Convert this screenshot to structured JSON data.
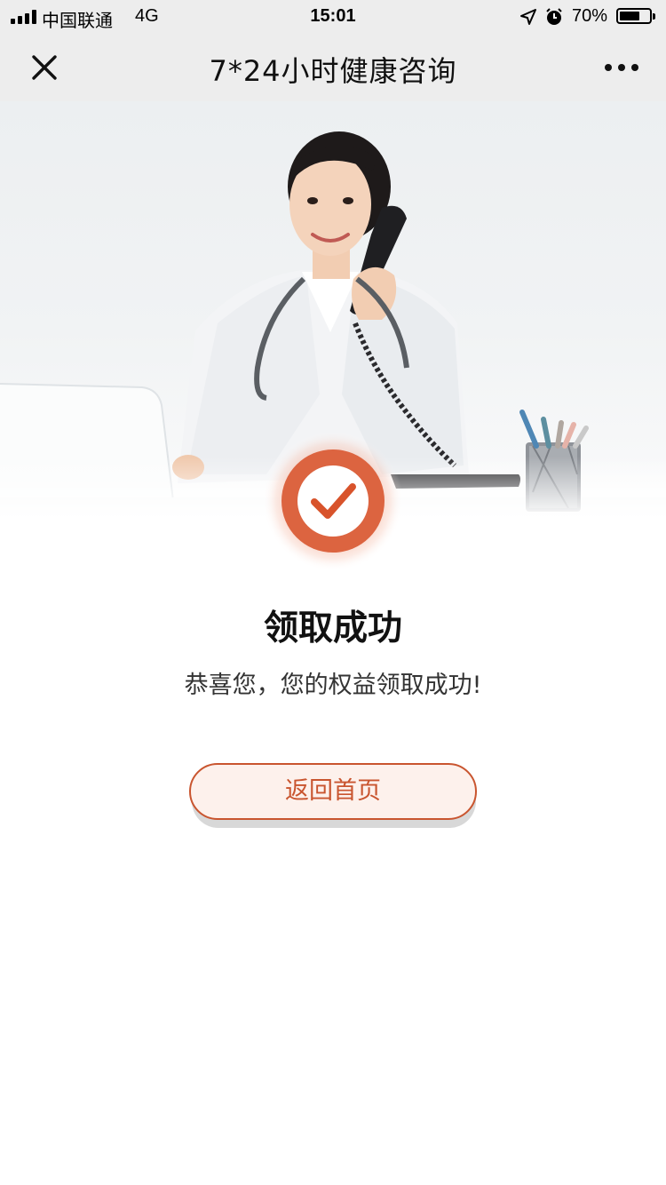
{
  "status_bar": {
    "carrier": "中国联通",
    "network": "4G",
    "time": "15:01",
    "battery_percent": "70%",
    "battery_level": 0.7,
    "icons": [
      "signal-icon",
      "location-icon",
      "alarm-icon",
      "battery-icon"
    ]
  },
  "nav": {
    "title": "7*24小时健康咨询",
    "close_icon": "close-icon",
    "more_icon": "more-icon"
  },
  "hero": {
    "image": "doctor-on-phone-illustration"
  },
  "result": {
    "icon": "check-icon",
    "title": "领取成功",
    "subtitle": "恭喜您，您的权益领取成功!"
  },
  "actions": {
    "home_label": "返回首页"
  },
  "colors": {
    "accent": "#c9552f",
    "button_bg": "#fdf1ec",
    "bar_bg": "#ededed",
    "badge_ring": "#dc6440"
  }
}
